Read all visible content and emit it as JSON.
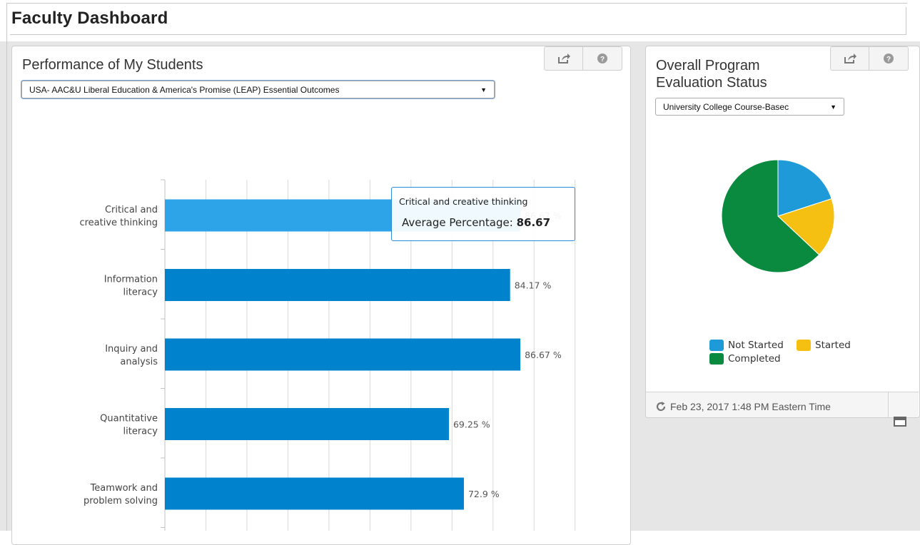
{
  "page": {
    "title": "Faculty Dashboard"
  },
  "performance_panel": {
    "title": "Performance of My Students",
    "framework_select_value": "USA- AAC&U Liberal Education & America's Promise (LEAP) Essential Outcomes",
    "toolbar": {
      "export_icon": "share-export-icon",
      "help_icon": "help-circle-icon"
    },
    "tooltip": {
      "category": "Critical and creative thinking",
      "label": "Average Percentage",
      "separator": ":",
      "value": "86.67"
    }
  },
  "status_panel": {
    "title_line1": "Overall Program",
    "title_line2": "Evaluation Status",
    "program_select_value": "University College Course-Basec",
    "toolbar": {
      "export_icon": "share-export-icon",
      "help_icon": "help-circle-icon"
    },
    "timestamp": "Feb 23, 2017 1:48 PM Eastern Time",
    "legend": [
      {
        "label": "Not Started",
        "color": "#1e9ad8"
      },
      {
        "label": "Started",
        "color": "#f5c011"
      },
      {
        "label": "Completed",
        "color": "#0a8a3e"
      }
    ]
  },
  "chart_data": [
    {
      "type": "bar",
      "orientation": "horizontal",
      "categories": [
        [
          "Critical and",
          "creative thinking"
        ],
        [
          "Information",
          "literacy"
        ],
        [
          "Inquiry and",
          "analysis"
        ],
        [
          "Quantitative",
          "literacy"
        ],
        [
          "Teamwork and",
          "problem solving"
        ]
      ],
      "values": [
        86.67,
        84.17,
        86.67,
        69.25,
        72.9
      ],
      "value_labels": [
        "86.67 %",
        "84.17 %",
        "86.67 %",
        "69.25 %",
        "72.9 %"
      ],
      "xlim": [
        0,
        100
      ],
      "grid": true,
      "colors": {
        "bar": "#0083cc",
        "highlight": "#2ea4e8"
      },
      "highlighted_index": 0
    },
    {
      "type": "pie",
      "labels": [
        "Not Started",
        "Started",
        "Completed"
      ],
      "values": [
        20,
        17,
        63
      ],
      "colors": [
        "#1e9ad8",
        "#f5c011",
        "#0a8a3e"
      ]
    }
  ]
}
